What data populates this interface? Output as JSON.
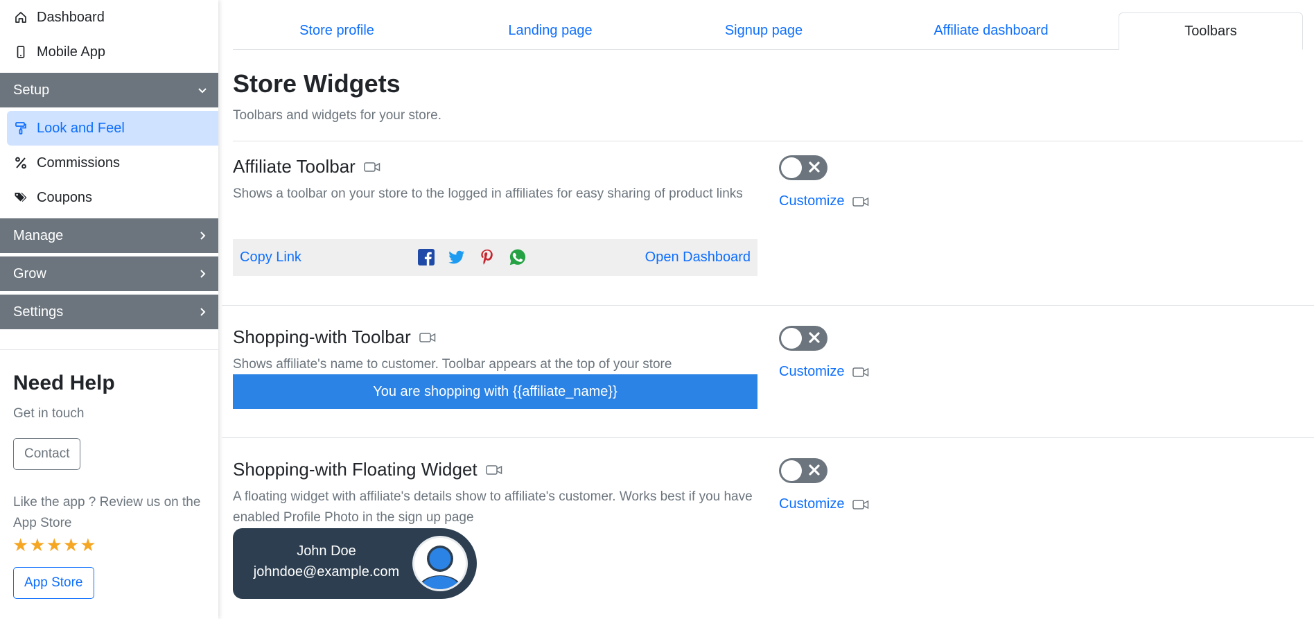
{
  "sidebar": {
    "items": [
      {
        "label": "Dashboard",
        "icon": "home-icon"
      },
      {
        "label": "Mobile App",
        "icon": "mobile-icon"
      }
    ],
    "sections": {
      "setup": "Setup",
      "manage": "Manage",
      "grow": "Grow",
      "settings": "Settings"
    },
    "setup_items": [
      {
        "label": "Look and Feel",
        "icon": "paint-roller-icon",
        "active": true
      },
      {
        "label": "Commissions",
        "icon": "percent-icon"
      },
      {
        "label": "Coupons",
        "icon": "tags-icon"
      }
    ],
    "help": {
      "title": "Need Help",
      "subtitle": "Get in touch",
      "contact_label": "Contact",
      "review_text": "Like the app ? Review us on the App Store",
      "stars": "★★★★★",
      "app_store_label": "App Store"
    }
  },
  "tabs": [
    {
      "label": "Store profile"
    },
    {
      "label": "Landing page"
    },
    {
      "label": "Signup page"
    },
    {
      "label": "Affiliate dashboard"
    },
    {
      "label": "Toolbars",
      "active": true
    }
  ],
  "main": {
    "title": "Store Widgets",
    "subtitle": "Toolbars and widgets for your store.",
    "customize_label": "Customize",
    "widgets": [
      {
        "title": "Affiliate Toolbar",
        "description": "Shows a toolbar on your store to the logged in affiliates for easy sharing of product links",
        "enabled": false,
        "preview": {
          "copy_link": "Copy Link",
          "open_dashboard": "Open Dashboard",
          "social_icons": [
            "facebook-icon",
            "twitter-icon",
            "pinterest-icon",
            "whatsapp-icon"
          ]
        }
      },
      {
        "title": "Shopping-with Toolbar",
        "description": "Shows affiliate's name to customer. Toolbar appears at the top of your store",
        "enabled": false,
        "preview": {
          "text": "You are shopping with {{affiliate_name}}"
        }
      },
      {
        "title": "Shopping-with Floating Widget",
        "description": "A floating widget with affiliate's details show to affiliate's customer. Works best if you have enabled Profile Photo in the sign up page",
        "enabled": false,
        "preview": {
          "name": "John Doe",
          "email": "johndoe@example.com"
        }
      }
    ]
  },
  "colors": {
    "primary": "#0d6efd",
    "section_bg": "#6c757d",
    "active_bg": "#cfe2ff",
    "shop_bar": "#2b83e5",
    "widget_dark": "#2c3e50",
    "star": "#f5a623"
  }
}
